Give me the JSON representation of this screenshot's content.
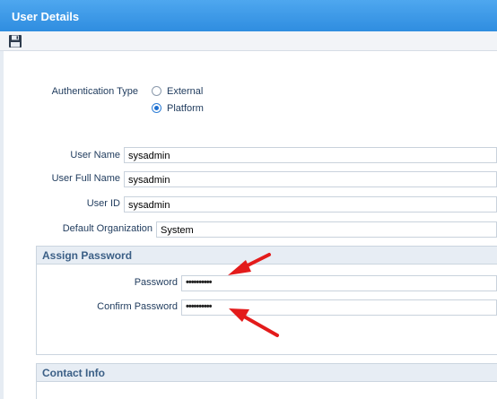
{
  "window": {
    "title": "User Details"
  },
  "toolbar": {
    "save_icon": "floppy-disk-save-icon"
  },
  "auth": {
    "label": "Authentication Type",
    "options": [
      {
        "label": "External",
        "selected": false
      },
      {
        "label": "Platform",
        "selected": true
      }
    ]
  },
  "user": {
    "name_label": "User Name",
    "name_value": "sysadmin",
    "full_name_label": "User Full Name",
    "full_name_value": "sysadmin",
    "id_label": "User ID",
    "id_value": "sysadmin",
    "org_label": "Default Organization",
    "org_value": "System"
  },
  "assign_password": {
    "title": "Assign Password",
    "password_label": "Password",
    "password_value": "••••••••••",
    "confirm_label": "Confirm Password",
    "confirm_value": "••••••••••"
  },
  "contact": {
    "title": "Contact Info"
  },
  "colors": {
    "title_bar": "#2f8de0",
    "annotation_arrow": "#e31b1b"
  }
}
